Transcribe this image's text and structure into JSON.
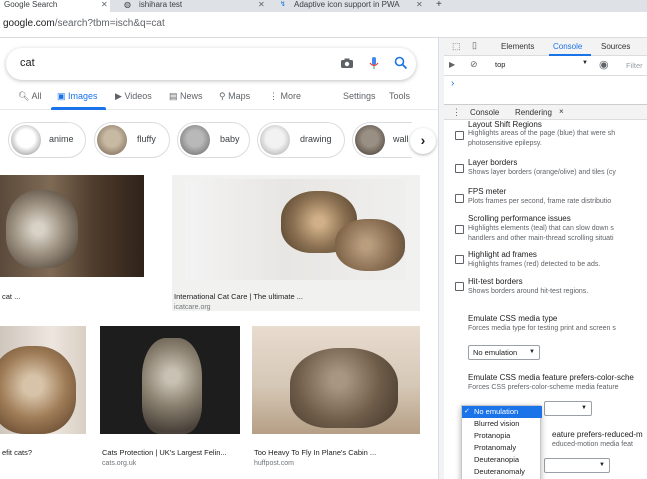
{
  "browser": {
    "tabs": [
      {
        "title": "Google Search",
        "active": true
      },
      {
        "title": "ishihara test",
        "active": false
      },
      {
        "title": "Adaptive icon support in PWA",
        "active": false
      }
    ],
    "new_tab_glyph": "+",
    "url_host": "google.com",
    "url_path": "/search?tbm=isch&q=cat"
  },
  "google": {
    "query": "cat",
    "nav": {
      "all": "All",
      "images": "Images",
      "videos": "Videos",
      "news": "News",
      "maps": "Maps",
      "more": "More",
      "settings": "Settings",
      "tools": "Tools"
    },
    "chips": [
      "anime",
      "fluffy",
      "baby",
      "drawing",
      "wall"
    ],
    "results": [
      {
        "caption": "cat ...",
        "source": ""
      },
      {
        "caption": "International Cat Care | The ultimate ...",
        "source": "icatcare.org"
      },
      {
        "caption": "efit cats?",
        "source": ""
      },
      {
        "caption": "Cats Protection | UK's Largest Felin...",
        "source": "cats.org.uk"
      },
      {
        "caption": "Too Heavy To Fly In Plane's Cabin ...",
        "source": "huffpost.com"
      }
    ]
  },
  "devtools": {
    "tabs": {
      "elements": "Elements",
      "console": "Console",
      "sources": "Sources"
    },
    "context": "top",
    "filter_placeholder": "Filter",
    "prompt": "›",
    "drawer_tabs": {
      "console": "Console",
      "rendering": "Rendering"
    },
    "close_glyph": "×",
    "options": [
      {
        "title": "Layout Shift Regions",
        "desc1": "Highlights areas of the page (blue) that were sh",
        "desc2": "photosensitive epilepsy."
      },
      {
        "title": "Layer borders",
        "desc1": "Shows layer borders (orange/olive) and tiles (cy",
        "desc2": ""
      },
      {
        "title": "FPS meter",
        "desc1": "Plots frames per second, frame rate distributio",
        "desc2": ""
      },
      {
        "title": "Scrolling performance issues",
        "desc1": "Highlights elements (teal) that can slow down s",
        "desc2": "handlers and other main-thread scrolling situati"
      },
      {
        "title": "Highlight ad frames",
        "desc1": "Highlights frames (red) detected to be ads.",
        "desc2": ""
      },
      {
        "title": "Hit-test borders",
        "desc1": "Shows borders around hit-test regions.",
        "desc2": ""
      }
    ],
    "media_type": {
      "title": "Emulate CSS media type",
      "desc": "Forces media type for testing print and screen s",
      "value": "No emulation"
    },
    "color_scheme": {
      "title": "Emulate CSS media feature prefers-color-sche",
      "desc": "Forces CSS prefers-color-scheme media feature"
    },
    "reduced_motion": {
      "title": "eature prefers-reduced-m",
      "desc": "educed-motion media feat"
    },
    "dropdown_options": [
      "No emulation",
      "Blurred vision",
      "Protanopia",
      "Protanomaly",
      "Deuteranopia",
      "Deuteranomaly"
    ]
  }
}
